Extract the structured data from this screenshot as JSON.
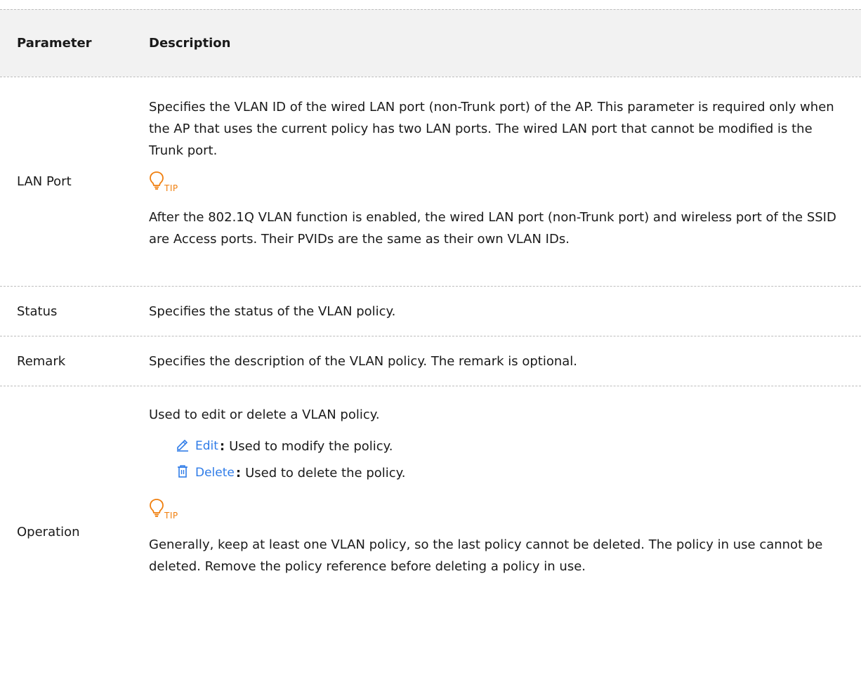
{
  "table": {
    "headers": {
      "parameter": "Parameter",
      "description": "Description"
    },
    "rows": {
      "lan_port": {
        "parameter": "LAN Port",
        "description": "Specifies the VLAN ID of the wired LAN port (non-Trunk port) of the AP. This parameter is required only when the AP that uses the current policy has two LAN ports. The wired LAN port that cannot be modified is the Trunk port.",
        "tip_label": "TIP",
        "tip_text": "After the 802.1Q VLAN function is enabled, the wired LAN port (non-Trunk port) and wireless port of the SSID are Access ports. Their PVIDs are the same as their own VLAN IDs."
      },
      "status": {
        "parameter": "Status",
        "description": "Specifies the status of the VLAN policy."
      },
      "remark": {
        "parameter": "Remark",
        "description": "Specifies the description of the VLAN policy. The remark is optional."
      },
      "operation": {
        "parameter": "Operation",
        "description": "Used to edit or delete a VLAN policy.",
        "edit_label": "Edit",
        "edit_desc": "Used to modify the policy.",
        "delete_label": "Delete",
        "delete_desc": "Used to delete the policy.",
        "separator": ":",
        "tip_label": "TIP",
        "tip_text": "Generally, keep at least one VLAN policy, so the last policy cannot be deleted. The policy in use cannot be deleted. Remove the policy reference before deleting a policy in use."
      }
    }
  },
  "colors": {
    "tip_accent": "#f07f0e",
    "link": "#2f7ce8",
    "header_bg": "#f2f2f2"
  }
}
